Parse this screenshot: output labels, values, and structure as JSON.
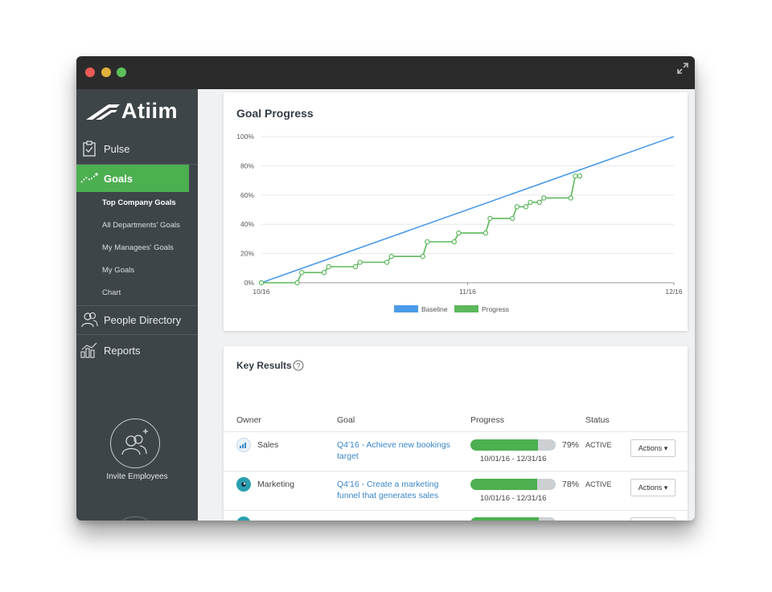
{
  "app": {
    "logo_text": "Atiim"
  },
  "sidebar": {
    "nav": {
      "pulse": "Pulse",
      "goals": "Goals",
      "people": "People Directory",
      "reports": "Reports"
    },
    "sub_items": [
      "Top Company Goals",
      "All Departments' Goals",
      "My Managees' Goals",
      "My Goals",
      "Chart"
    ],
    "invite_label": "Invite Employees"
  },
  "goal_progress": {
    "title": "Goal Progress",
    "chart_data": {
      "type": "line",
      "y_ticks": [
        "0%",
        "20%",
        "40%",
        "60%",
        "80%",
        "100%"
      ],
      "x_ticks": [
        "10/16",
        "11/16",
        "12/16"
      ],
      "ylim": [
        0,
        100
      ],
      "series": [
        {
          "name": "Baseline",
          "color": "#4c9be8",
          "values": [
            [
              0,
              0
            ],
            [
              92,
              100
            ]
          ]
        },
        {
          "name": "Progress",
          "color": "#5cb85c",
          "values": [
            [
              0,
              0
            ],
            [
              8,
              0
            ],
            [
              9,
              7
            ],
            [
              14,
              7
            ],
            [
              15,
              11
            ],
            [
              21,
              11
            ],
            [
              22,
              14
            ],
            [
              28,
              14
            ],
            [
              29,
              18
            ],
            [
              36,
              18
            ],
            [
              37,
              28
            ],
            [
              43,
              28
            ],
            [
              44,
              34
            ],
            [
              50,
              34
            ],
            [
              51,
              44
            ],
            [
              56,
              44
            ],
            [
              57,
              52
            ],
            [
              59,
              52
            ],
            [
              60,
              55
            ],
            [
              62,
              55
            ],
            [
              63,
              58
            ],
            [
              69,
              58
            ],
            [
              70,
              73
            ],
            [
              71,
              73
            ]
          ]
        }
      ],
      "legend": [
        "Baseline",
        "Progress"
      ],
      "legend_position": "bottom"
    }
  },
  "key_results": {
    "title": "Key Results",
    "help_icon": "question-icon",
    "headers": {
      "owner": "Owner",
      "goal": "Goal",
      "progress": "Progress",
      "status": "Status"
    },
    "rows": [
      {
        "owner": "Sales",
        "goal": "Q4'16 - Achieve new bookings target",
        "progress": 79,
        "progress_label": "79%",
        "dates": "10/01/16 - 12/31/16",
        "status": "ACTIVE",
        "action": "Actions ▾",
        "icon_color": "#e9f2f9"
      },
      {
        "owner": "Marketing",
        "goal": "Q4'16 - Create a marketing funnel that generates sales",
        "progress": 78,
        "progress_label": "78%",
        "dates": "10/01/16 - 12/31/16",
        "status": "ACTIVE",
        "action": "Actions ▾",
        "icon_color": "#2a9fb0"
      }
    ]
  }
}
